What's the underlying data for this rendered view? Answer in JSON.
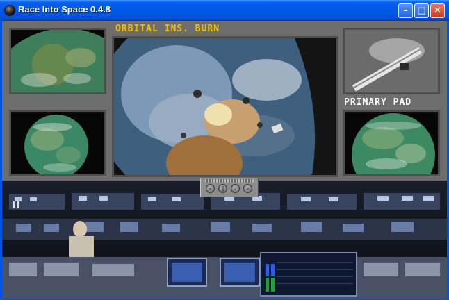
{
  "window": {
    "title": "Race Into Space 0.4.8",
    "buttons": {
      "minimize": "–",
      "maximize": "□",
      "close": "✕"
    }
  },
  "game": {
    "main_view_label": "ORBITAL INS. BURN",
    "side_view_label": "PRIMARY PAD",
    "playback_controls": [
      "rewind",
      "pause",
      "play",
      "fast-forward"
    ],
    "playback_symbols": [
      "«",
      "‖",
      "›",
      "»"
    ]
  },
  "colors": {
    "main_label": "#f0c000",
    "side_label": "#ffffff",
    "panel_gray": "#6e6e6e",
    "earth_green": "#4a9a6a",
    "space_black": "#0c0c0c"
  }
}
